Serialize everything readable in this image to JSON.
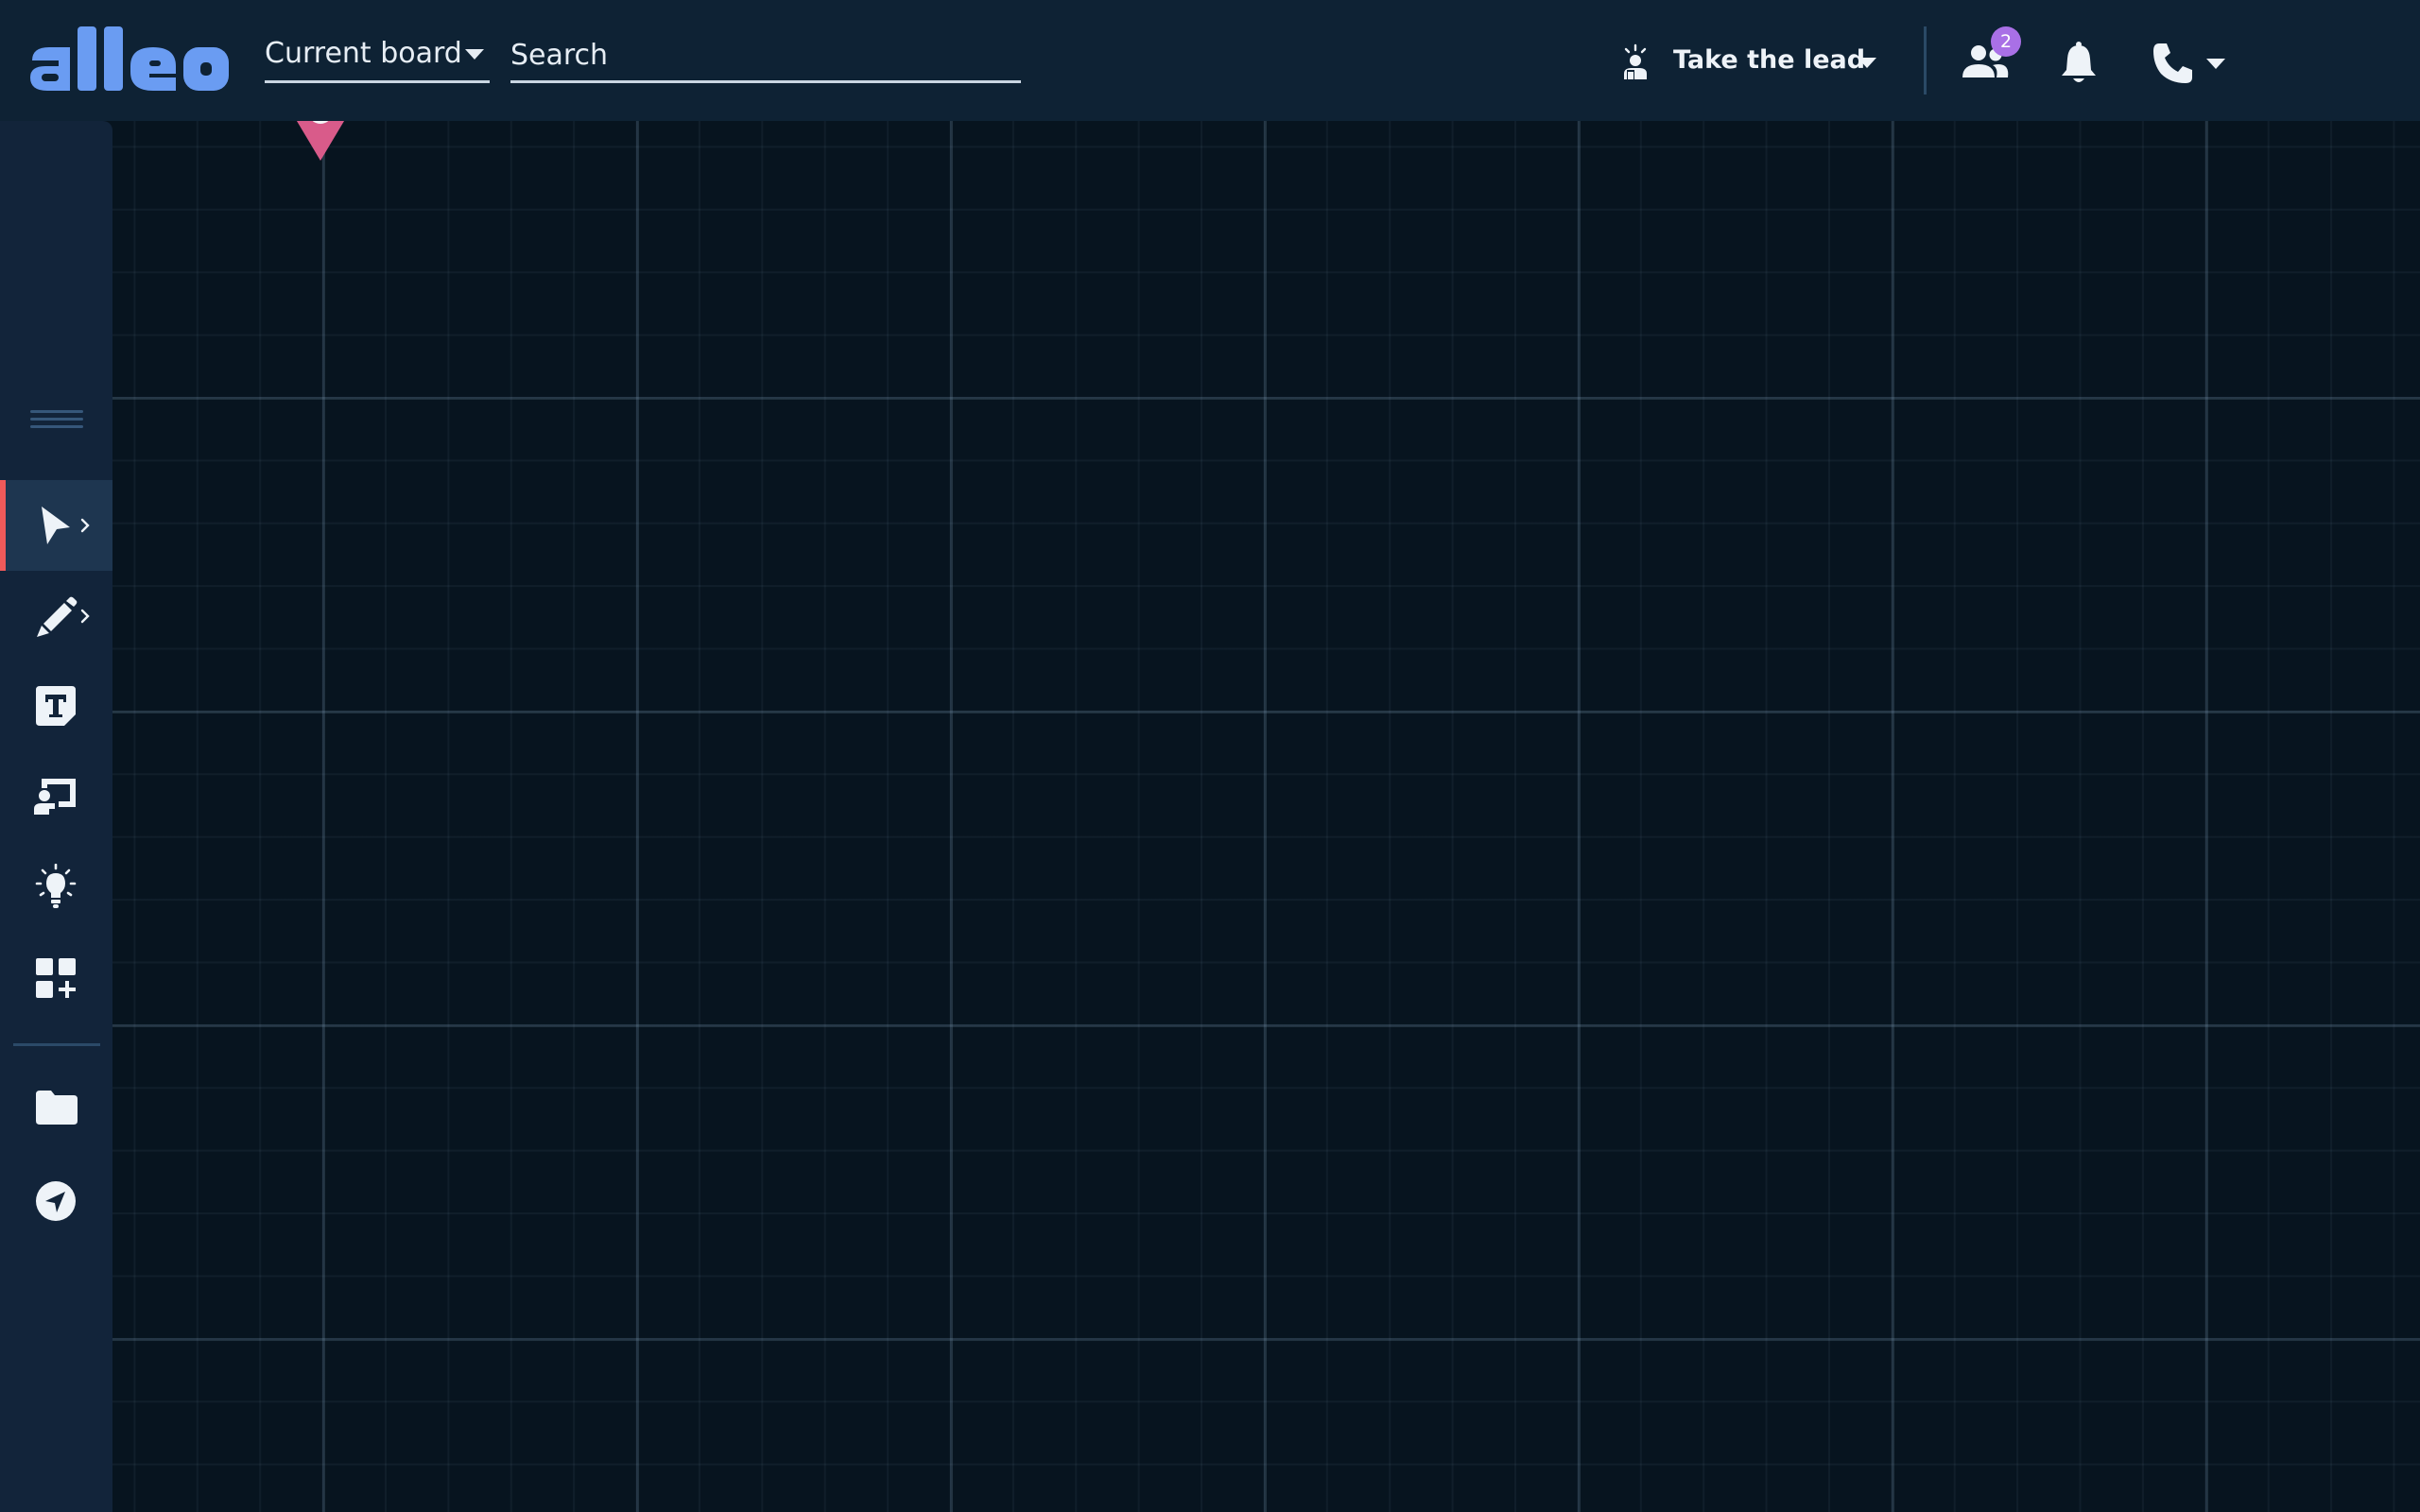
{
  "app": {
    "name": "alleo"
  },
  "header": {
    "board_select": {
      "label": "Current board"
    },
    "search": {
      "placeholder": "Search",
      "value": ""
    },
    "lead": {
      "label": "Take the lead",
      "icon": "take-the-lead-icon"
    },
    "participants": {
      "count": "2",
      "icon": "users-icon"
    },
    "notifications": {
      "icon": "bell-icon"
    },
    "call": {
      "icon": "phone-icon"
    }
  },
  "sidebar": {
    "tools": [
      {
        "name": "select",
        "icon": "cursor-icon",
        "active": true,
        "has_submenu": true
      },
      {
        "name": "draw",
        "icon": "pencil-icon",
        "active": false,
        "has_submenu": true
      },
      {
        "name": "text",
        "icon": "text-icon",
        "active": false,
        "has_submenu": false
      },
      {
        "name": "presentation",
        "icon": "presenter-icon",
        "active": false,
        "has_submenu": false
      },
      {
        "name": "ideas",
        "icon": "lightbulb-icon",
        "active": false,
        "has_submenu": false
      },
      {
        "name": "apps",
        "icon": "add-widget-icon",
        "active": false,
        "has_submenu": false
      },
      {
        "name": "files",
        "icon": "folder-icon",
        "active": false,
        "has_submenu": false
      },
      {
        "name": "navigate",
        "icon": "navigation-icon",
        "active": false,
        "has_submenu": false
      }
    ]
  },
  "colors": {
    "background": "#07141f",
    "topbar": "#0e2234",
    "sidebar": "#12243a",
    "logo": "#6a9cf2",
    "active_indicator": "#ef5a5a",
    "badge": "#a970e6",
    "pin": "#d95b8a"
  }
}
